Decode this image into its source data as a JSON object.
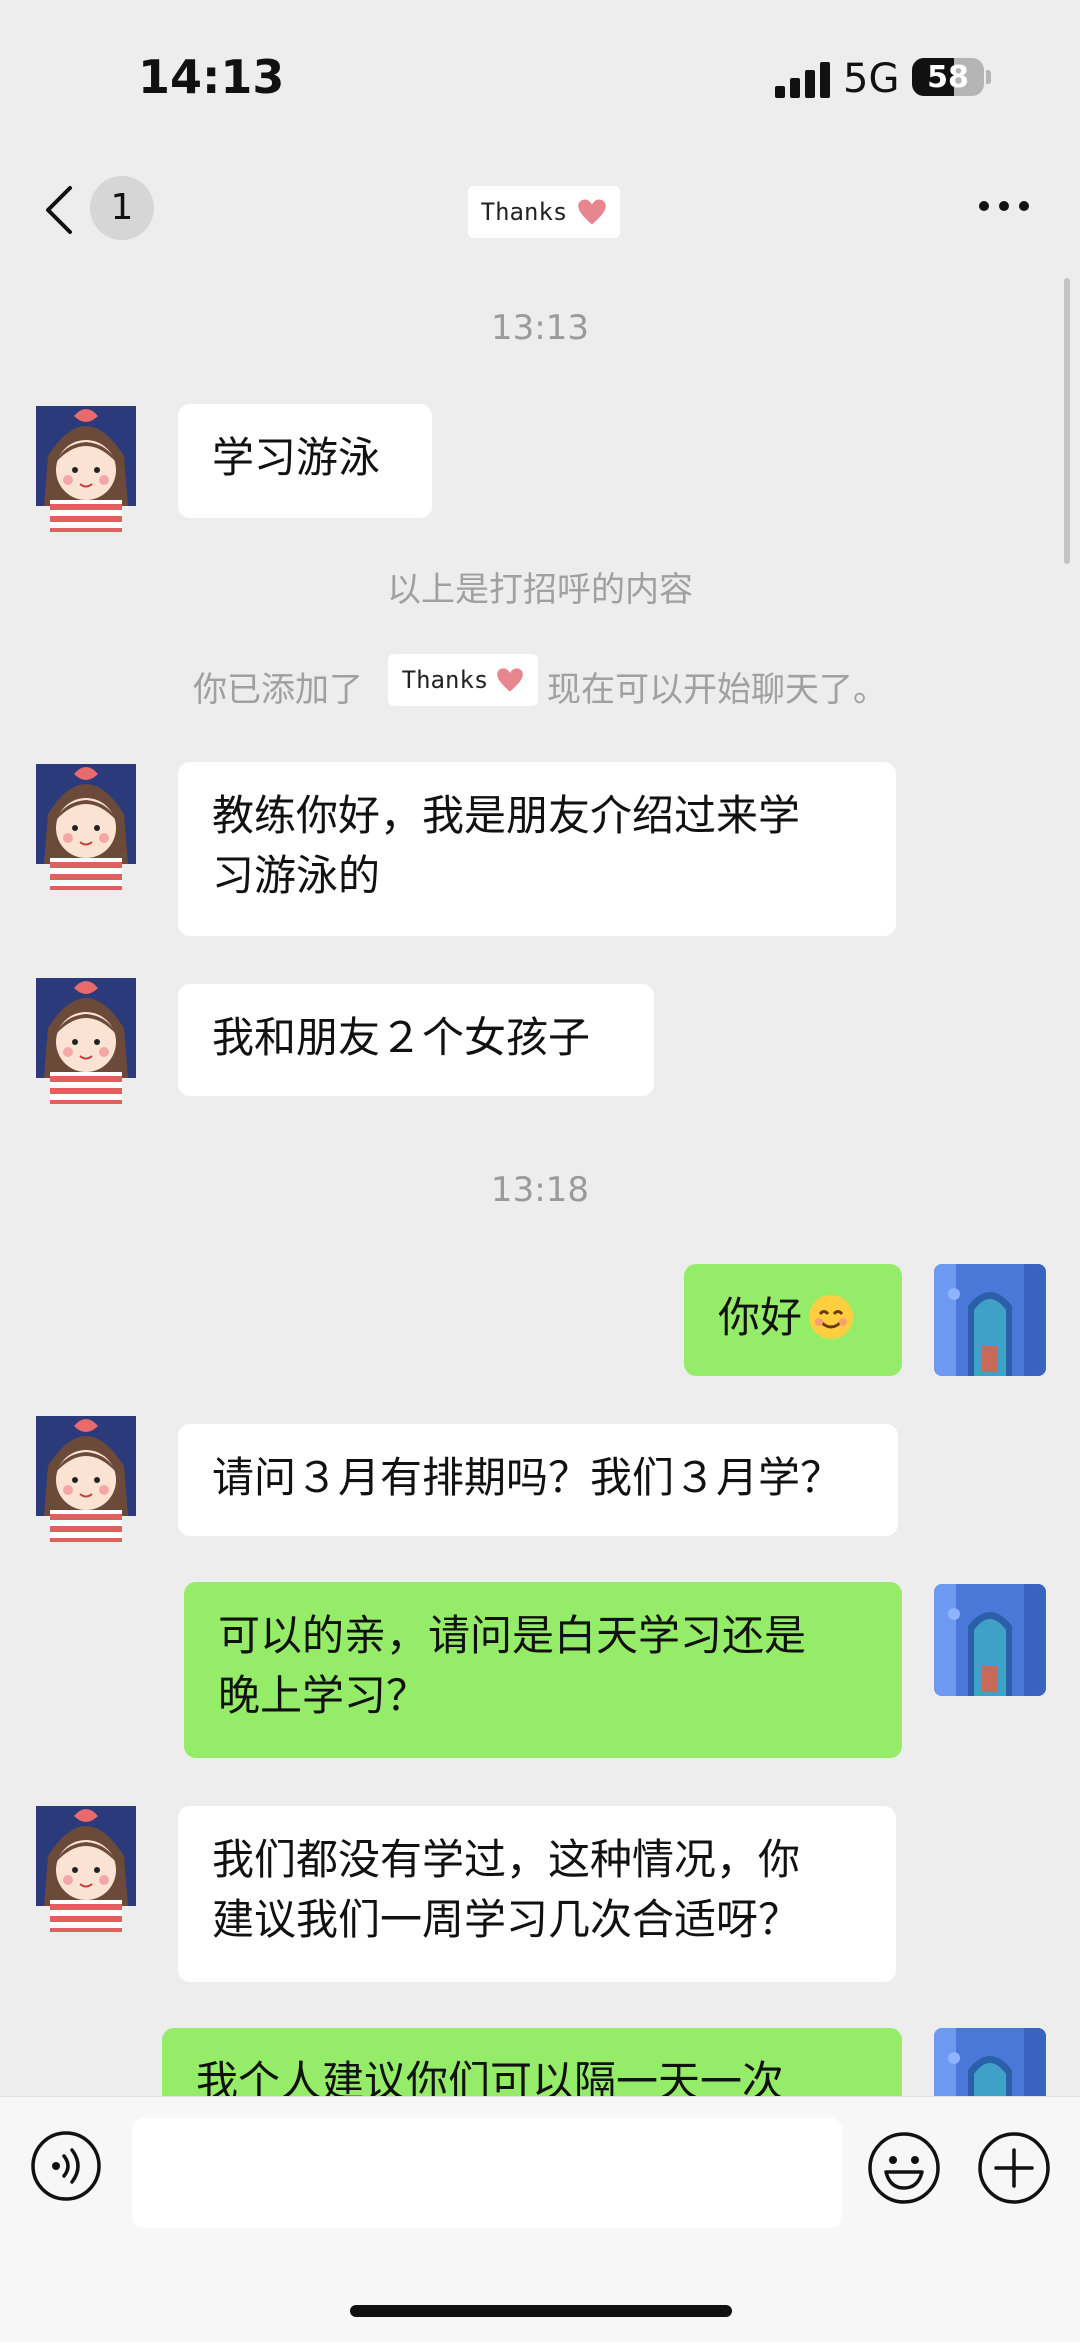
{
  "status_bar": {
    "time": "14:13",
    "network": "5G",
    "battery_percent": "58",
    "battery_level": 0.58
  },
  "nav": {
    "unread_count": "1",
    "contact_name": "Thanks"
  },
  "messages": [
    {
      "type": "timestamp",
      "text": "13:13"
    },
    {
      "type": "incoming",
      "text": "学习游泳"
    },
    {
      "type": "system",
      "text": "以上是打招呼的内容"
    },
    {
      "type": "system",
      "prefix": "你已添加了",
      "tag": "Thanks",
      "suffix": "，现在可以开始聊天了。"
    },
    {
      "type": "incoming",
      "lines": [
        "教练你好，我是朋友介绍过来学",
        "习游泳的"
      ]
    },
    {
      "type": "incoming",
      "text": "我和朋友２个女孩子"
    },
    {
      "type": "timestamp",
      "text": "13:18"
    },
    {
      "type": "outgoing",
      "text": "你好",
      "emoji": "smiling-face"
    },
    {
      "type": "incoming",
      "text": "请问３月有排期吗？我们３月学？"
    },
    {
      "type": "outgoing",
      "lines": [
        "可以的亲，请问是白天学习还是",
        "晚上学习？"
      ]
    },
    {
      "type": "incoming",
      "lines": [
        "我们都没有学过，这种情况，你",
        "建议我们一周学习几次合适呀？"
      ]
    },
    {
      "type": "outgoing",
      "text": "我个人建议你们可以隔一天一次"
    }
  ],
  "input_bar": {
    "placeholder": ""
  },
  "colors": {
    "background": "#ededed",
    "outgoing_bubble": "#95ec69",
    "incoming_bubble": "#ffffff",
    "heart": "#e8868f"
  }
}
